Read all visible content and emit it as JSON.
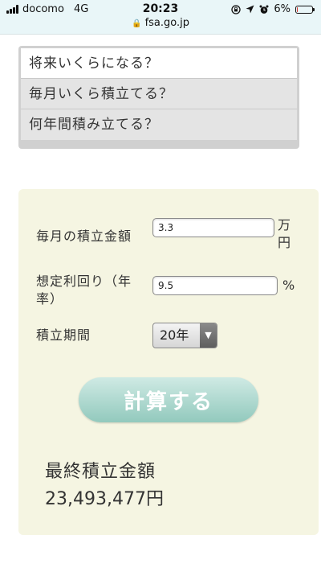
{
  "status_bar": {
    "carrier": "docomo",
    "network": "4G",
    "time": "20:23",
    "battery_percent": "6%",
    "battery_level": 0.06,
    "battery_color": "#d6362f",
    "icons": [
      "signal-icon",
      "lock-rotation-icon",
      "location-arrow-icon",
      "alarm-icon",
      "battery-icon"
    ]
  },
  "browser": {
    "url": "fsa.go.jp",
    "lock_icon": "🔒"
  },
  "menu": {
    "items": [
      {
        "label": "将来いくらになる？",
        "selected": true
      },
      {
        "label": "毎月いくら積立てる？",
        "selected": false
      },
      {
        "label": "何年間積み立てる？",
        "selected": false
      }
    ]
  },
  "form": {
    "monthly_amount_label": "毎月の積立金額",
    "monthly_amount_value": "3.3",
    "monthly_amount_unit": "万円",
    "return_rate_label": "想定利回り（年率）",
    "return_rate_value": "9.5",
    "return_rate_unit": "%",
    "period_label": "積立期間",
    "period_value": "20年",
    "period_arrow": "▼",
    "calculate_label": "計算する"
  },
  "result": {
    "label": "最終積立金額",
    "value": "23,493,477円"
  },
  "colors": {
    "status_bar_bg": "#e9f6f8",
    "panel_bg": "#f5f5e2",
    "menu_frame": "#d0d0d0",
    "menu_item_bg": "#e4e4e4",
    "button_gradient_top": "#cfeae4",
    "button_gradient_bottom": "#92c9bd"
  }
}
